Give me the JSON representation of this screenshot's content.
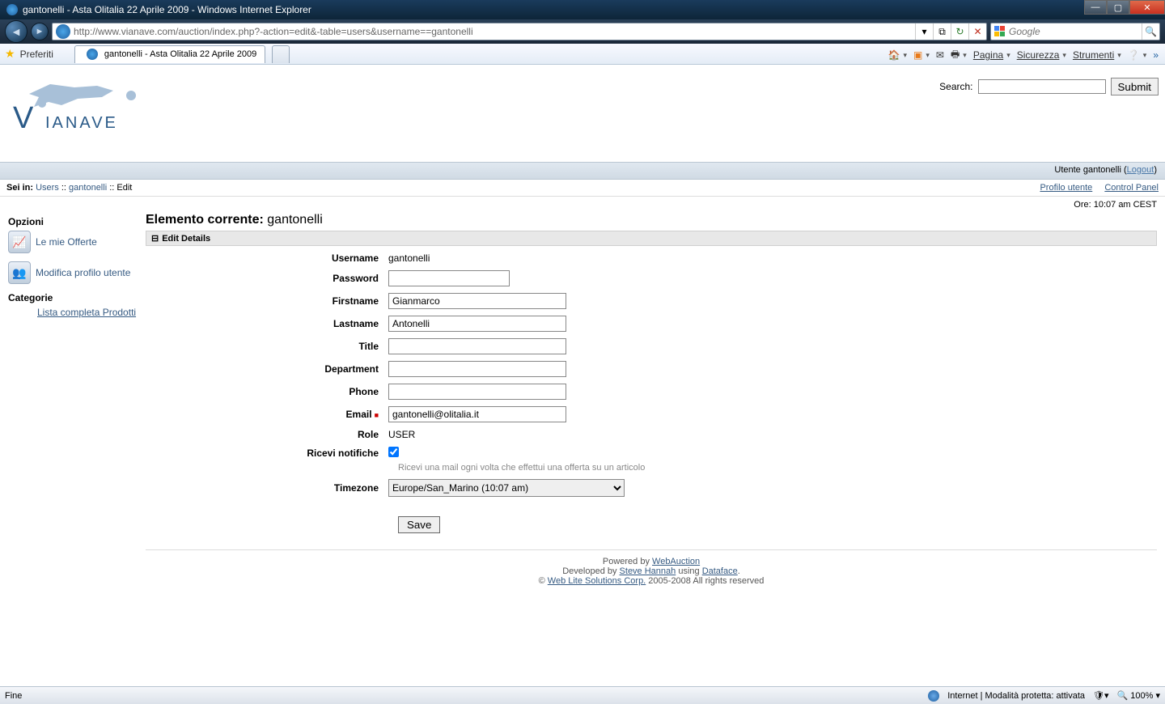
{
  "window": {
    "title": "gantonelli - Asta Olitalia 22 Aprile 2009 - Windows Internet Explorer"
  },
  "address_bar": {
    "url": "http://www.vianave.com/auction/index.php?-action=edit&-table=users&username==gantonelli"
  },
  "search_box": {
    "placeholder": "Google"
  },
  "favorites_label": "Preferiti",
  "tab": {
    "title": "gantonelli - Asta Olitalia 22 Aprile 2009"
  },
  "cmdbar": {
    "pagina": "Pagina",
    "sicurezza": "Sicurezza",
    "strumenti": "Strumenti"
  },
  "search_form": {
    "label": "Search:",
    "submit": "Submit"
  },
  "userbar": {
    "text": "Utente gantonelli (",
    "logout": "Logout",
    "close": ")"
  },
  "breadcrumb": {
    "prefix": "Sei in:",
    "users": "Users",
    "sep": " :: ",
    "user": "gantonelli",
    "edit": "Edit"
  },
  "topright_links": {
    "profilo": "Profilo utente",
    "cp": "Control Panel"
  },
  "time": "Ore: 10:07 am CEST",
  "sidebar": {
    "opzioni": "Opzioni",
    "mie_offerte": "Le mie Offerte",
    "modifica_profilo": "Modifica profilo utente",
    "categorie": "Categorie",
    "lista_prodotti": "Lista completa Prodotti"
  },
  "main": {
    "heading_prefix": "Elemento corrente: ",
    "heading_value": "gantonelli",
    "section": "Edit Details",
    "labels": {
      "username": "Username",
      "password": "Password",
      "firstname": "Firstname",
      "lastname": "Lastname",
      "title": "Title",
      "department": "Department",
      "phone": "Phone",
      "email": "Email",
      "role": "Role",
      "ricevi": "Ricevi notifiche",
      "timezone": "Timezone"
    },
    "values": {
      "username": "gantonelli",
      "password": "",
      "firstname": "Gianmarco",
      "lastname": "Antonelli",
      "title": "",
      "department": "",
      "phone": "",
      "email": "gantonelli@olitalia.it",
      "role": "USER",
      "ricevi_checked": true,
      "timezone": "Europe/San_Marino (10:07 am)"
    },
    "hint": "Ricevi una mail ogni volta che effettui una offerta su un articolo",
    "save": "Save"
  },
  "footer": {
    "l1a": "Powered by ",
    "l1b": "WebAuction",
    "l2a": "Developed by ",
    "l2b": "Steve Hannah",
    "l2c": " using ",
    "l2d": "Dataface",
    "l2e": ".",
    "l3a": "© ",
    "l3b": "Web Lite Solutions Corp.",
    "l3c": " 2005-2008 All rights reserved"
  },
  "status": {
    "left": "Fine",
    "internet": "Internet | Modalità protetta: attivata",
    "zoom": "100%"
  }
}
